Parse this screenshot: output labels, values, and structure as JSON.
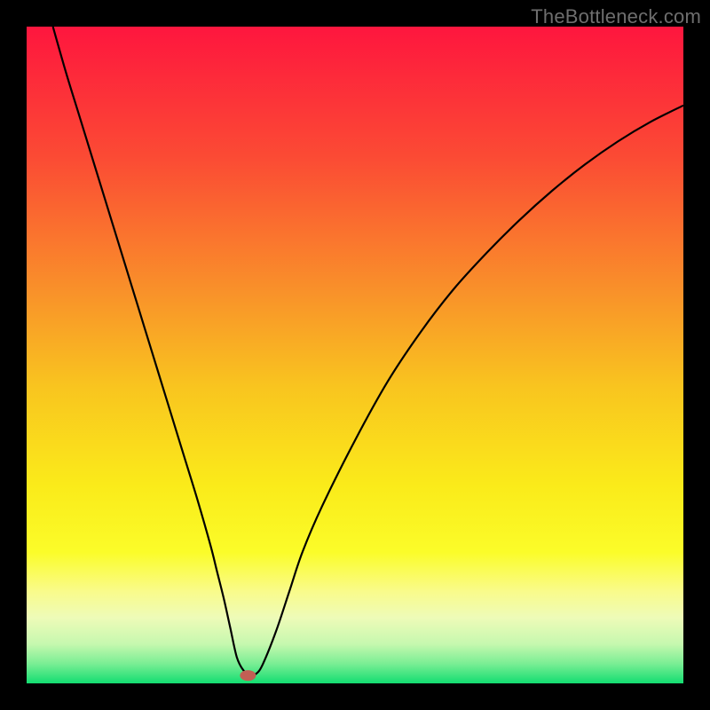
{
  "watermark": "TheBottleneck.com",
  "chart_data": {
    "type": "line",
    "title": "",
    "xlabel": "",
    "ylabel": "",
    "xlim": [
      0,
      100
    ],
    "ylim": [
      0,
      100
    ],
    "grid": false,
    "legend": false,
    "annotations": [],
    "background_gradient": {
      "stops": [
        {
          "offset": 0.0,
          "color": "#fe163e"
        },
        {
          "offset": 0.2,
          "color": "#fb4b34"
        },
        {
          "offset": 0.4,
          "color": "#f9902a"
        },
        {
          "offset": 0.55,
          "color": "#f9c51f"
        },
        {
          "offset": 0.7,
          "color": "#faeb1a"
        },
        {
          "offset": 0.8,
          "color": "#fbfc29"
        },
        {
          "offset": 0.86,
          "color": "#f9fb8b"
        },
        {
          "offset": 0.9,
          "color": "#eefbb8"
        },
        {
          "offset": 0.94,
          "color": "#c6f8af"
        },
        {
          "offset": 0.97,
          "color": "#7aee94"
        },
        {
          "offset": 1.0,
          "color": "#13dd71"
        }
      ]
    },
    "series": [
      {
        "name": "bottleneck-curve",
        "color": "#000000",
        "width": 2.2,
        "x": [
          4,
          6,
          8,
          10,
          12,
          14,
          16,
          18,
          20,
          22,
          24,
          26,
          28,
          29,
          30,
          31,
          32,
          33,
          34,
          35,
          36,
          38,
          40,
          42,
          45,
          50,
          55,
          60,
          65,
          70,
          75,
          80,
          85,
          90,
          95,
          100
        ],
        "y": [
          100,
          93,
          86.5,
          80,
          73.5,
          67,
          60.5,
          54,
          47.5,
          41,
          34.5,
          28,
          21,
          17,
          13,
          8.5,
          4,
          2,
          1.3,
          1.5,
          3,
          8,
          14,
          20,
          27,
          37,
          46,
          53.5,
          60,
          65.5,
          70.5,
          75,
          79,
          82.5,
          85.5,
          88
        ]
      }
    ],
    "marker": {
      "name": "highlight-point",
      "x": 33.7,
      "y": 1.2,
      "color": "#c35f54",
      "rx": 9,
      "ry": 6
    }
  }
}
